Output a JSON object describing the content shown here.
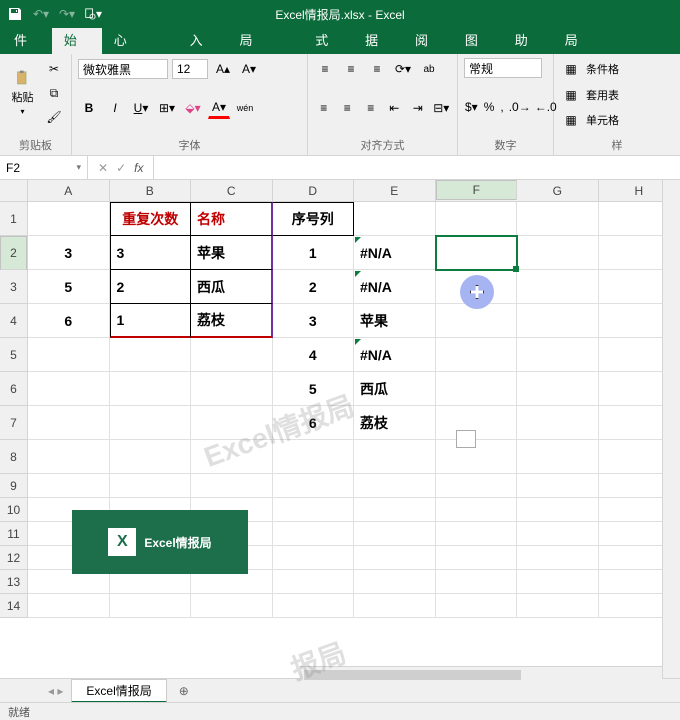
{
  "title": "Excel情报局.xlsx - Excel",
  "tabs": {
    "file": "文件",
    "home": "开始",
    "template": "模板中心",
    "insert": "插入",
    "layout": "页面布局",
    "formula": "公式",
    "data": "数据",
    "review": "审阅",
    "view": "视图",
    "help": "帮助",
    "follow": "关注：Excel情报局"
  },
  "ribbon": {
    "clipboard": {
      "paste": "粘贴",
      "label": "剪贴板"
    },
    "font": {
      "name": "微软雅黑",
      "size": "12",
      "wen": "wén",
      "label": "字体"
    },
    "align": {
      "wrap": "ab",
      "label": "对齐方式"
    },
    "number": {
      "format": "常规",
      "label": "数字"
    },
    "styles": {
      "cond": "条件格",
      "table": "套用表",
      "cell": "单元格",
      "label": "样"
    }
  },
  "refbar": {
    "name": "F2",
    "fx": "fx"
  },
  "columns": [
    "A",
    "B",
    "C",
    "D",
    "E",
    "F",
    "G",
    "H"
  ],
  "rows": [
    "1",
    "2",
    "3",
    "4",
    "5",
    "6",
    "7",
    "8",
    "9",
    "10",
    "11",
    "12",
    "13",
    "14"
  ],
  "table1": {
    "hdr_repeat": "重复次数",
    "hdr_name": "名称",
    "r": [
      {
        "a": "3",
        "b": "3",
        "c": "苹果"
      },
      {
        "a": "5",
        "b": "2",
        "c": "西瓜"
      },
      {
        "a": "6",
        "b": "1",
        "c": "荔枝"
      }
    ]
  },
  "table2": {
    "hdr_seq": "序号列",
    "rows": [
      {
        "d": "1",
        "e": "#N/A"
      },
      {
        "d": "2",
        "e": "#N/A"
      },
      {
        "d": "3",
        "e": "苹果"
      },
      {
        "d": "4",
        "e": "#N/A"
      },
      {
        "d": "5",
        "e": "西瓜"
      },
      {
        "d": "6",
        "e": "荔枝"
      }
    ]
  },
  "logo_text": "Excel情报局",
  "watermark1": "Excel情报局",
  "watermark2": "报局",
  "sheet_tab": "Excel情报局",
  "status": "就绪"
}
